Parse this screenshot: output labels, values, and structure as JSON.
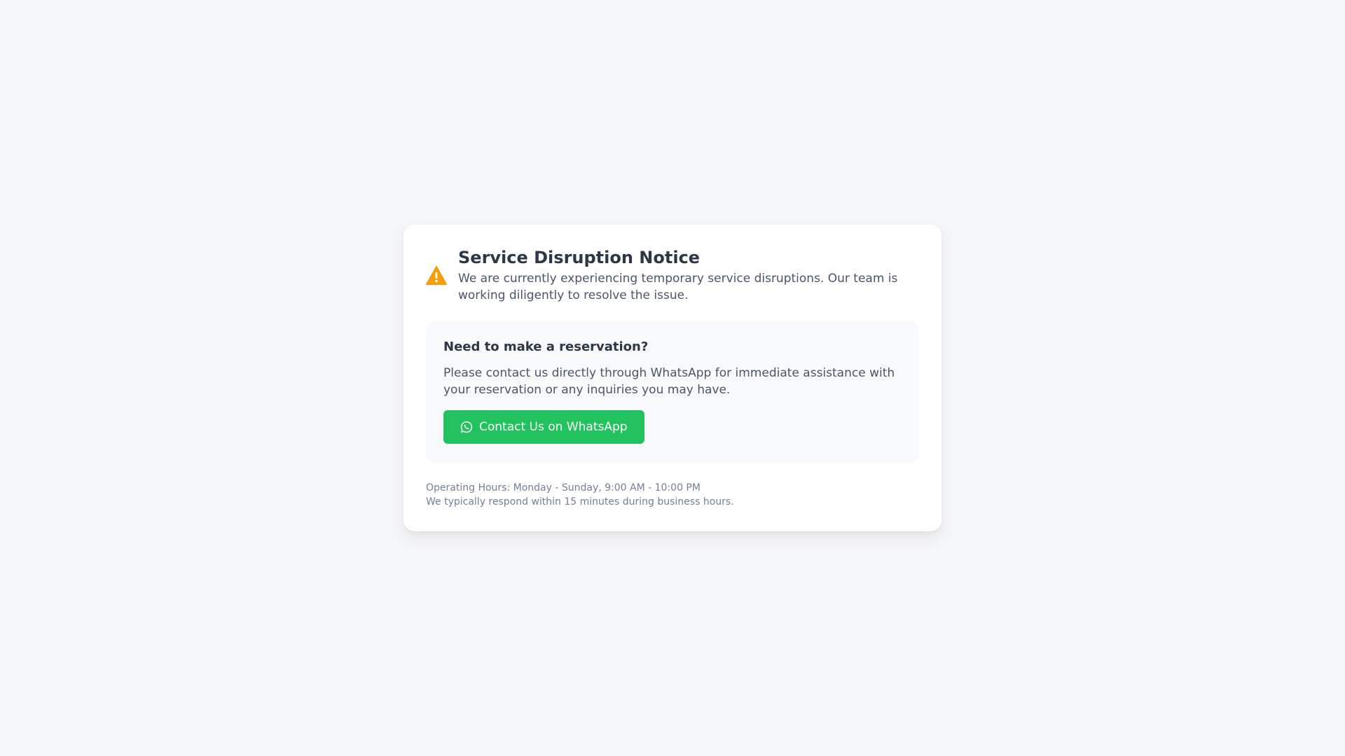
{
  "notice": {
    "title": "Service Disruption Notice",
    "message": "We are currently experiencing temporary service disruptions. Our team is working diligently to resolve the issue.",
    "icon": "warning-icon",
    "icon_color": "#f59e0b"
  },
  "reservation": {
    "heading": "Need to make a reservation?",
    "text": "Please contact us directly through WhatsApp for immediate assistance with your reservation or any inquiries you may have.",
    "button_label": "Contact Us on WhatsApp",
    "button_icon": "whatsapp-icon",
    "button_color": "#22c35e"
  },
  "footer": {
    "hours": "Operating Hours: Monday - Sunday, 9:00 AM - 10:00 PM",
    "response": "We typically respond within 15 minutes during business hours."
  }
}
